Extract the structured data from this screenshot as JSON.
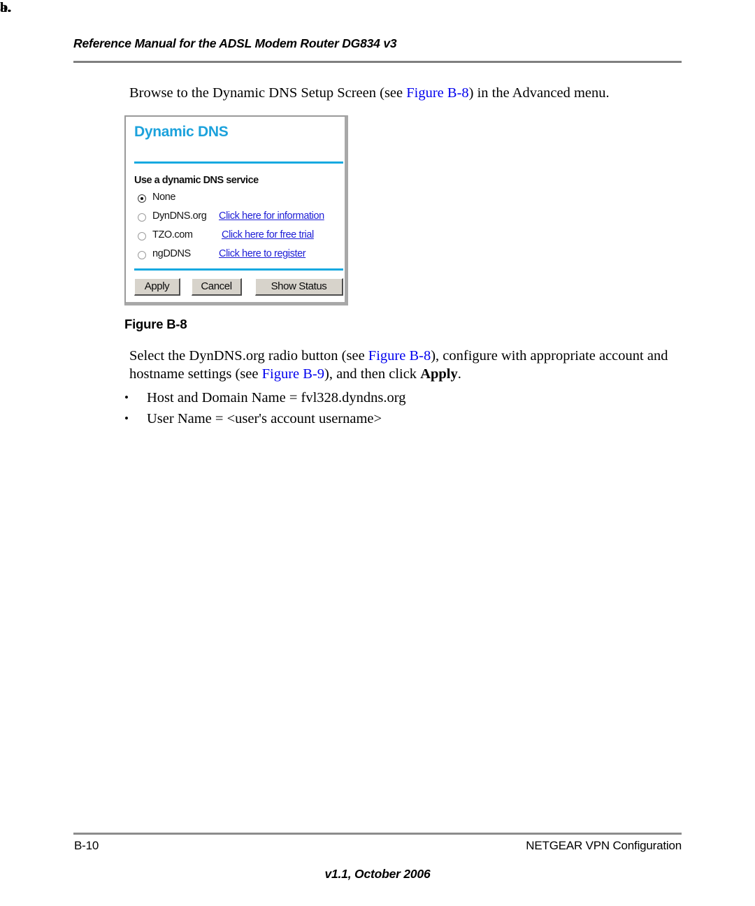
{
  "header": {
    "title": "Reference Manual for the ADSL Modem Router DG834 v3"
  },
  "steps": {
    "a": {
      "label": "a.",
      "text_before": "Browse to the Dynamic DNS Setup Screen (see ",
      "figure_link": "Figure B-8",
      "text_after": ") in the Advanced menu."
    },
    "b": {
      "label": "b.",
      "part1": "Select the DynDNS.org radio button (see ",
      "figure_link_1": "Figure B-8",
      "part2": "), configure with appropriate account and hostname settings (see ",
      "figure_link_2": "Figure B-9",
      "part3": "), and then click ",
      "apply_bold": "Apply",
      "part4": "."
    }
  },
  "bullets": [
    {
      "marker": "•",
      "text": "Host and Domain Name = fvl328.dyndns.org"
    },
    {
      "marker": "•",
      "text": "User Name = <user's account username>"
    }
  ],
  "figure": {
    "caption": "Figure B-8",
    "dialog": {
      "title": "Dynamic DNS",
      "section_label": "Use a dynamic DNS service",
      "accent_color": "#16a9e0",
      "link_color": "#1d1dd6",
      "options": [
        {
          "label": "None",
          "selected": true,
          "link": ""
        },
        {
          "label": "DynDNS.org",
          "selected": false,
          "link": "Click here for information"
        },
        {
          "label": "TZO.com",
          "selected": false,
          "link": "Click here for free trial"
        },
        {
          "label": "ngDDNS",
          "selected": false,
          "link": "Click here to register"
        }
      ],
      "buttons": {
        "apply": "Apply",
        "cancel": "Cancel",
        "show_status": "Show Status"
      }
    }
  },
  "footer": {
    "page_number": "B-10",
    "section": "NETGEAR VPN Configuration",
    "version": "v1.1, October 2006"
  }
}
